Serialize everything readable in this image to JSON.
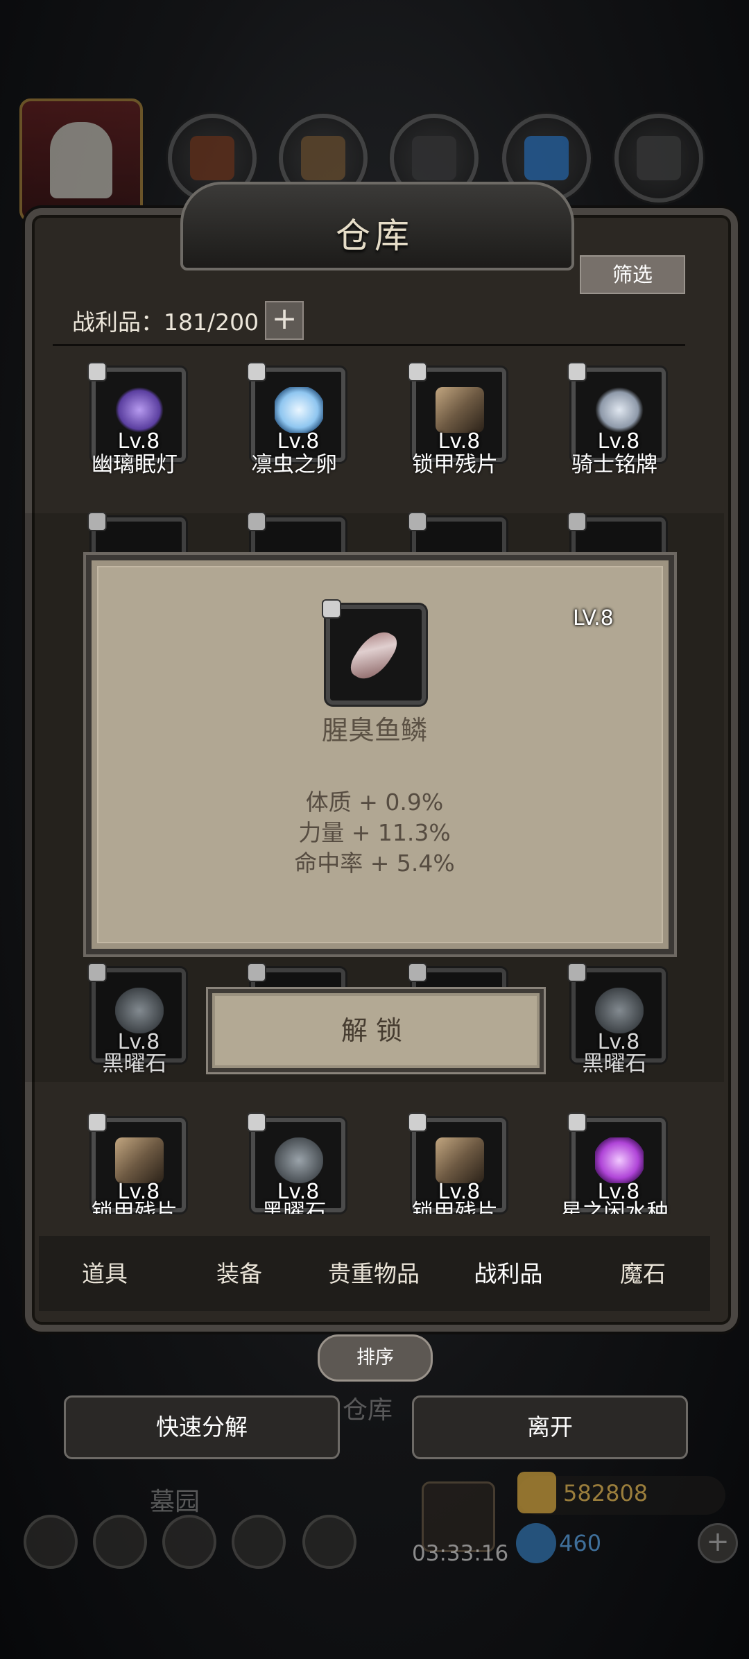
{
  "header": {
    "title": "仓库",
    "filter_label": "筛选",
    "trophy_label": "战利品：181/200",
    "add_label": "+"
  },
  "grid": {
    "row1": [
      {
        "name": "幽璃眠灯",
        "level": "Lv.8",
        "color": "#5b3fa0"
      },
      {
        "name": "凛虫之卵",
        "level": "Lv.8",
        "color": "#8fc6f0"
      },
      {
        "name": "锁甲残片",
        "level": "Lv.8",
        "color": "#6e5a43"
      },
      {
        "name": "骑士铭牌",
        "level": "Lv.8",
        "color": "#8f9aaa"
      }
    ],
    "row3": [
      {
        "name": "黑曜石",
        "level": "Lv.8",
        "color": "#6c7379"
      },
      {
        "name": "黑曜石",
        "level": "Lv.8",
        "color": "#6c7379"
      }
    ],
    "row4": [
      {
        "name": "锁甲残片",
        "level": "Lv.8",
        "color": "#6e5a43"
      },
      {
        "name": "黑曜石",
        "level": "Lv.8",
        "color": "#6c7379"
      },
      {
        "name": "锁甲残片",
        "level": "Lv.8",
        "color": "#6e5a43"
      },
      {
        "name": "星之闲水种",
        "level": "Lv.8",
        "color": "#b045d8"
      }
    ]
  },
  "popup": {
    "level": "LV.8",
    "item_name": "腥臭鱼鳞",
    "stats": [
      "体质 + 0.9%",
      "力量 + 11.3%",
      "命中率 + 5.4%"
    ],
    "unlock_label": "解锁"
  },
  "tabs": [
    {
      "label": "道具"
    },
    {
      "label": "装备"
    },
    {
      "label": "贵重物品"
    },
    {
      "label": "战利品",
      "active": true
    },
    {
      "label": "魔石"
    }
  ],
  "sort_label": "排序",
  "background_label": "仓库",
  "bottom": {
    "decompose_label": "快速分解",
    "leave_label": "离开",
    "cemetery_label": "墓园",
    "gold": "582808",
    "gems": "460",
    "timer": "03:33:16"
  }
}
